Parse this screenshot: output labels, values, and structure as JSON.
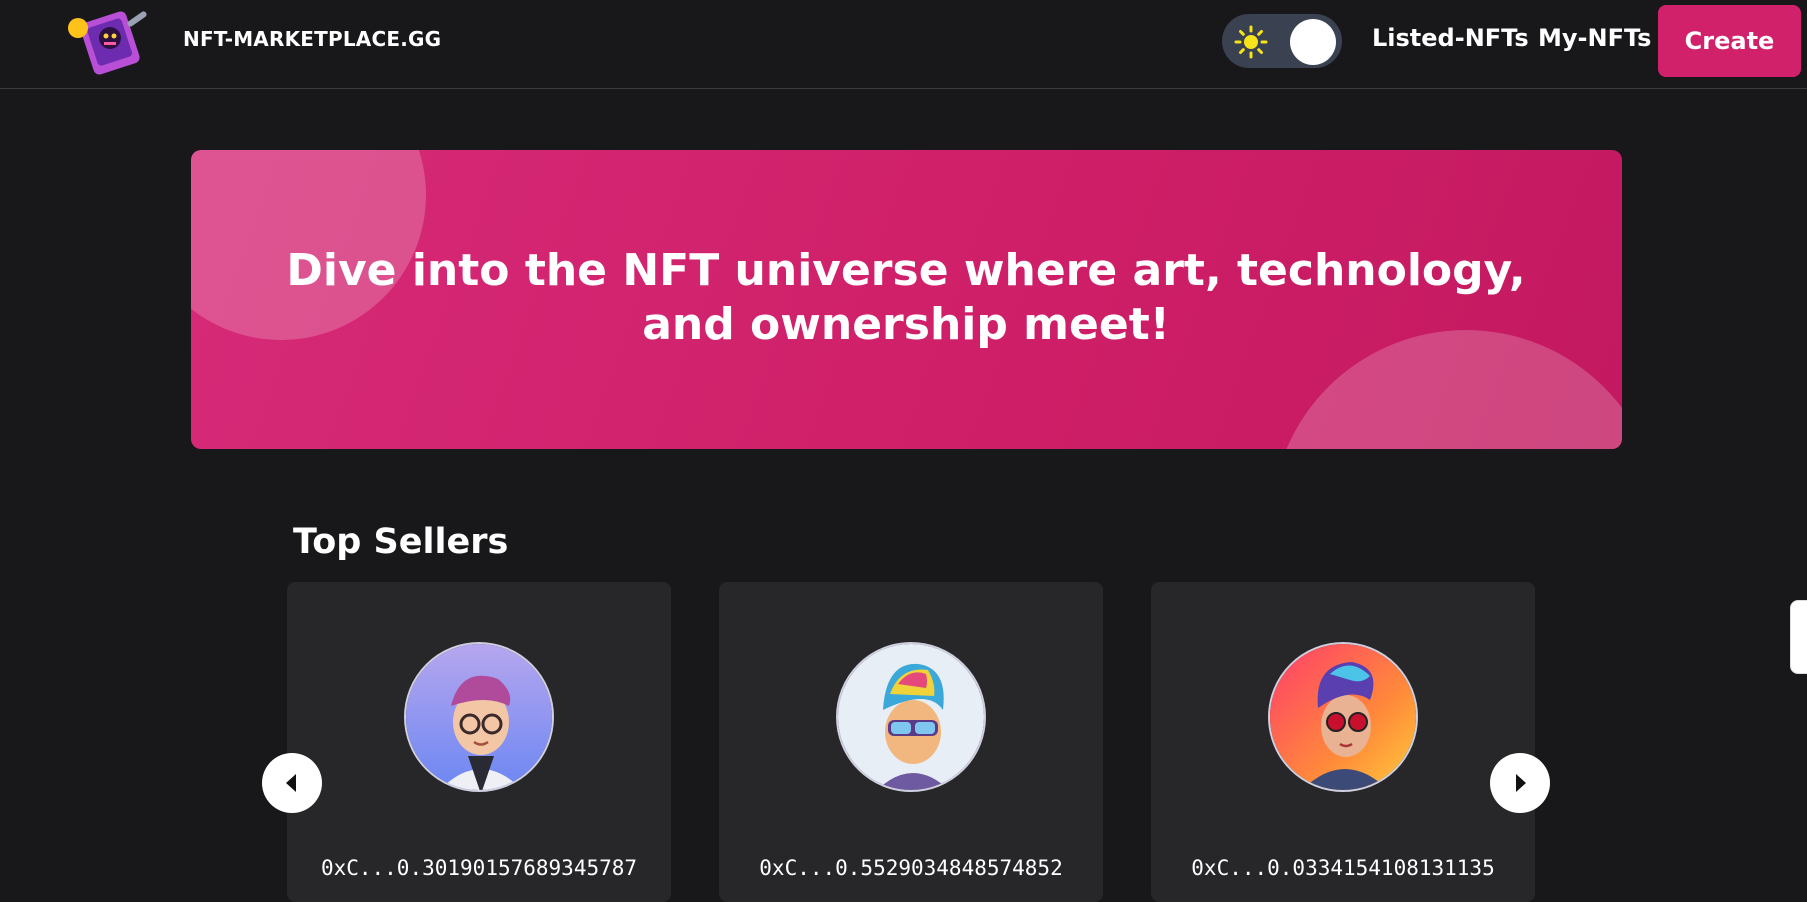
{
  "header": {
    "brand": "NFT-MARKETPLACE.GG",
    "nav": {
      "listed": "Listed-NFTs",
      "my": "My-NFTs",
      "create": "Create"
    },
    "theme_toggle": {
      "icon": "sun-icon",
      "mode": "dark"
    },
    "colors": {
      "accent": "#d2216b",
      "background": "#18181b"
    }
  },
  "hero": {
    "headline": "Dive into the NFT universe where art, technology, and ownership meet!"
  },
  "top_sellers": {
    "title": "Top Sellers",
    "sellers": [
      {
        "address": "0xC...0.30190157689345787",
        "avatar": "avatar-glasses-labcoat"
      },
      {
        "address": "0xC...0.5529034848574852",
        "avatar": "avatar-rainbow-hair-sunglasses"
      },
      {
        "address": "0xC...0.0334154108131135",
        "avatar": "avatar-punk-red-sunglasses"
      }
    ],
    "prev_icon": "chevron-left-icon",
    "next_icon": "chevron-right-icon"
  }
}
